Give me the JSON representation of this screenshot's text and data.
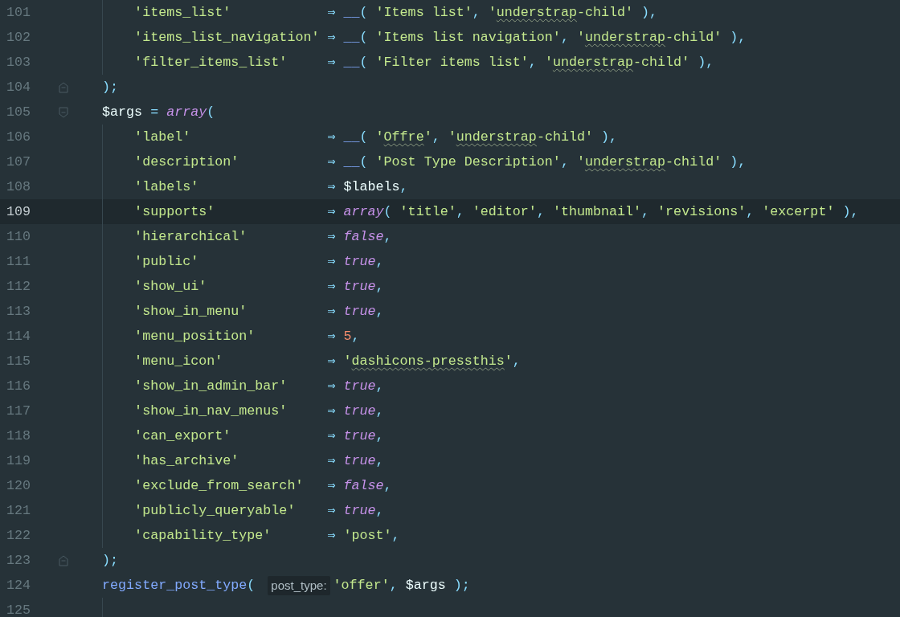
{
  "editor": {
    "lines": [
      {
        "number": "101",
        "current": false,
        "tokens": [
          {
            "kind": "key",
            "text": "        'items_list'"
          },
          {
            "kind": "op",
            "text": "⇒ "
          },
          {
            "kind": "fn",
            "text": "__"
          },
          {
            "kind": "punct",
            "text": "( "
          },
          {
            "kind": "str",
            "text": "'Items list'"
          },
          {
            "kind": "punct",
            "text": ", "
          },
          {
            "kind": "str",
            "text": "'"
          },
          {
            "kind": "typo",
            "text": "understrap"
          },
          {
            "kind": "str",
            "text": "-child'"
          },
          {
            "kind": "punct",
            "text": " ),"
          }
        ]
      },
      {
        "number": "102",
        "current": false,
        "tokens": [
          {
            "kind": "key",
            "text": "        'items_list_navigation'"
          },
          {
            "kind": "op",
            "text": "⇒ "
          },
          {
            "kind": "fn",
            "text": "__"
          },
          {
            "kind": "punct",
            "text": "( "
          },
          {
            "kind": "str",
            "text": "'Items list navigation'"
          },
          {
            "kind": "punct",
            "text": ", "
          },
          {
            "kind": "str",
            "text": "'"
          },
          {
            "kind": "typo",
            "text": "understrap"
          },
          {
            "kind": "str",
            "text": "-child'"
          },
          {
            "kind": "punct",
            "text": " ),"
          }
        ]
      },
      {
        "number": "103",
        "current": false,
        "tokens": [
          {
            "kind": "key",
            "text": "        'filter_items_list'"
          },
          {
            "kind": "op",
            "text": "⇒ "
          },
          {
            "kind": "fn",
            "text": "__"
          },
          {
            "kind": "punct",
            "text": "( "
          },
          {
            "kind": "str",
            "text": "'Filter items list'"
          },
          {
            "kind": "punct",
            "text": ", "
          },
          {
            "kind": "str",
            "text": "'"
          },
          {
            "kind": "typo",
            "text": "understrap"
          },
          {
            "kind": "str",
            "text": "-child'"
          },
          {
            "kind": "punct",
            "text": " ),"
          }
        ]
      },
      {
        "number": "104",
        "current": false,
        "fold_close": true,
        "tokens": [
          {
            "kind": "punct",
            "text": "    );"
          }
        ]
      },
      {
        "number": "105",
        "current": false,
        "fold_open": true,
        "tokens": [
          {
            "kind": "var",
            "text": "    $args"
          },
          {
            "kind": "op",
            "text": " = "
          },
          {
            "kind": "kw",
            "text": "array"
          },
          {
            "kind": "punct",
            "text": "("
          }
        ]
      },
      {
        "number": "106",
        "current": false,
        "tokens": [
          {
            "kind": "key",
            "text": "        'label'"
          },
          {
            "kind": "op",
            "text": "⇒ "
          },
          {
            "kind": "fn",
            "text": "__"
          },
          {
            "kind": "punct",
            "text": "( "
          },
          {
            "kind": "str",
            "text": "'"
          },
          {
            "kind": "typo",
            "text": "Offre"
          },
          {
            "kind": "str",
            "text": "'"
          },
          {
            "kind": "punct",
            "text": ", "
          },
          {
            "kind": "str",
            "text": "'"
          },
          {
            "kind": "typo",
            "text": "understrap"
          },
          {
            "kind": "str",
            "text": "-child'"
          },
          {
            "kind": "punct",
            "text": " ),"
          }
        ]
      },
      {
        "number": "107",
        "current": false,
        "tokens": [
          {
            "kind": "key",
            "text": "        'description'"
          },
          {
            "kind": "op",
            "text": "⇒ "
          },
          {
            "kind": "fn",
            "text": "__"
          },
          {
            "kind": "punct",
            "text": "( "
          },
          {
            "kind": "str",
            "text": "'Post Type Description'"
          },
          {
            "kind": "punct",
            "text": ", "
          },
          {
            "kind": "str",
            "text": "'"
          },
          {
            "kind": "typo",
            "text": "understrap"
          },
          {
            "kind": "str",
            "text": "-child'"
          },
          {
            "kind": "punct",
            "text": " ),"
          }
        ]
      },
      {
        "number": "108",
        "current": false,
        "tokens": [
          {
            "kind": "key",
            "text": "        'labels'"
          },
          {
            "kind": "op",
            "text": "⇒ "
          },
          {
            "kind": "var",
            "text": "$labels"
          },
          {
            "kind": "punct",
            "text": ","
          }
        ]
      },
      {
        "number": "109",
        "current": true,
        "tokens": [
          {
            "kind": "key",
            "text": "        'supports'"
          },
          {
            "kind": "op",
            "text": "⇒ "
          },
          {
            "kind": "kw",
            "text": "array"
          },
          {
            "kind": "punct",
            "text": "( "
          },
          {
            "kind": "str",
            "text": "'title'"
          },
          {
            "kind": "punct",
            "text": ", "
          },
          {
            "kind": "str",
            "text": "'editor'"
          },
          {
            "kind": "punct",
            "text": ", "
          },
          {
            "kind": "str",
            "text": "'thumbnail'"
          },
          {
            "kind": "punct",
            "text": ", "
          },
          {
            "kind": "str",
            "text": "'revisions'"
          },
          {
            "kind": "punct",
            "text": ", "
          },
          {
            "kind": "str",
            "text": "'excerpt'"
          },
          {
            "kind": "punct",
            "text": " ),"
          }
        ]
      },
      {
        "number": "110",
        "current": false,
        "tokens": [
          {
            "kind": "key",
            "text": "        'hierarchical'"
          },
          {
            "kind": "op",
            "text": "⇒ "
          },
          {
            "kind": "kw",
            "text": "false"
          },
          {
            "kind": "punct",
            "text": ","
          }
        ]
      },
      {
        "number": "111",
        "current": false,
        "tokens": [
          {
            "kind": "key",
            "text": "        'public'"
          },
          {
            "kind": "op",
            "text": "⇒ "
          },
          {
            "kind": "kw",
            "text": "true"
          },
          {
            "kind": "punct",
            "text": ","
          }
        ]
      },
      {
        "number": "112",
        "current": false,
        "tokens": [
          {
            "kind": "key",
            "text": "        'show_ui'"
          },
          {
            "kind": "op",
            "text": "⇒ "
          },
          {
            "kind": "kw",
            "text": "true"
          },
          {
            "kind": "punct",
            "text": ","
          }
        ]
      },
      {
        "number": "113",
        "current": false,
        "tokens": [
          {
            "kind": "key",
            "text": "        'show_in_menu'"
          },
          {
            "kind": "op",
            "text": "⇒ "
          },
          {
            "kind": "kw",
            "text": "true"
          },
          {
            "kind": "punct",
            "text": ","
          }
        ]
      },
      {
        "number": "114",
        "current": false,
        "tokens": [
          {
            "kind": "key",
            "text": "        'menu_position'"
          },
          {
            "kind": "op",
            "text": "⇒ "
          },
          {
            "kind": "num",
            "text": "5"
          },
          {
            "kind": "punct",
            "text": ","
          }
        ]
      },
      {
        "number": "115",
        "current": false,
        "tokens": [
          {
            "kind": "key",
            "text": "        'menu_icon'"
          },
          {
            "kind": "op",
            "text": "⇒ "
          },
          {
            "kind": "str",
            "text": "'"
          },
          {
            "kind": "typo",
            "text": "dashicons-pressthis"
          },
          {
            "kind": "str",
            "text": "'"
          },
          {
            "kind": "punct",
            "text": ","
          }
        ]
      },
      {
        "number": "116",
        "current": false,
        "tokens": [
          {
            "kind": "key",
            "text": "        'show_in_admin_bar'"
          },
          {
            "kind": "op",
            "text": "⇒ "
          },
          {
            "kind": "kw",
            "text": "true"
          },
          {
            "kind": "punct",
            "text": ","
          }
        ]
      },
      {
        "number": "117",
        "current": false,
        "tokens": [
          {
            "kind": "key",
            "text": "        'show_in_nav_menus'"
          },
          {
            "kind": "op",
            "text": "⇒ "
          },
          {
            "kind": "kw",
            "text": "true"
          },
          {
            "kind": "punct",
            "text": ","
          }
        ]
      },
      {
        "number": "118",
        "current": false,
        "tokens": [
          {
            "kind": "key",
            "text": "        'can_export'"
          },
          {
            "kind": "op",
            "text": "⇒ "
          },
          {
            "kind": "kw",
            "text": "true"
          },
          {
            "kind": "punct",
            "text": ","
          }
        ]
      },
      {
        "number": "119",
        "current": false,
        "tokens": [
          {
            "kind": "key",
            "text": "        'has_archive'"
          },
          {
            "kind": "op",
            "text": "⇒ "
          },
          {
            "kind": "kw",
            "text": "true"
          },
          {
            "kind": "punct",
            "text": ","
          }
        ]
      },
      {
        "number": "120",
        "current": false,
        "tokens": [
          {
            "kind": "key",
            "text": "        'exclude_from_search'"
          },
          {
            "kind": "op",
            "text": "⇒ "
          },
          {
            "kind": "kw",
            "text": "false"
          },
          {
            "kind": "punct",
            "text": ","
          }
        ]
      },
      {
        "number": "121",
        "current": false,
        "tokens": [
          {
            "kind": "key",
            "text": "        'publicly_queryable'"
          },
          {
            "kind": "op",
            "text": "⇒ "
          },
          {
            "kind": "kw",
            "text": "true"
          },
          {
            "kind": "punct",
            "text": ","
          }
        ]
      },
      {
        "number": "122",
        "current": false,
        "tokens": [
          {
            "kind": "key",
            "text": "        'capability_type'"
          },
          {
            "kind": "op",
            "text": "⇒ "
          },
          {
            "kind": "str",
            "text": "'post'"
          },
          {
            "kind": "punct",
            "text": ","
          }
        ]
      },
      {
        "number": "123",
        "current": false,
        "fold_close": true,
        "tokens": [
          {
            "kind": "punct",
            "text": "    );"
          }
        ]
      },
      {
        "number": "124",
        "current": false,
        "tokens": [
          {
            "kind": "fn",
            "text": "    register_post_type"
          },
          {
            "kind": "punct",
            "text": "( "
          },
          {
            "kind": "hint",
            "text": "post_type:"
          },
          {
            "kind": "str",
            "text": "'offer'"
          },
          {
            "kind": "punct",
            "text": ", "
          },
          {
            "kind": "var",
            "text": "$args"
          },
          {
            "kind": "punct",
            "text": " );"
          }
        ]
      },
      {
        "number": "125",
        "current": false
      }
    ]
  }
}
